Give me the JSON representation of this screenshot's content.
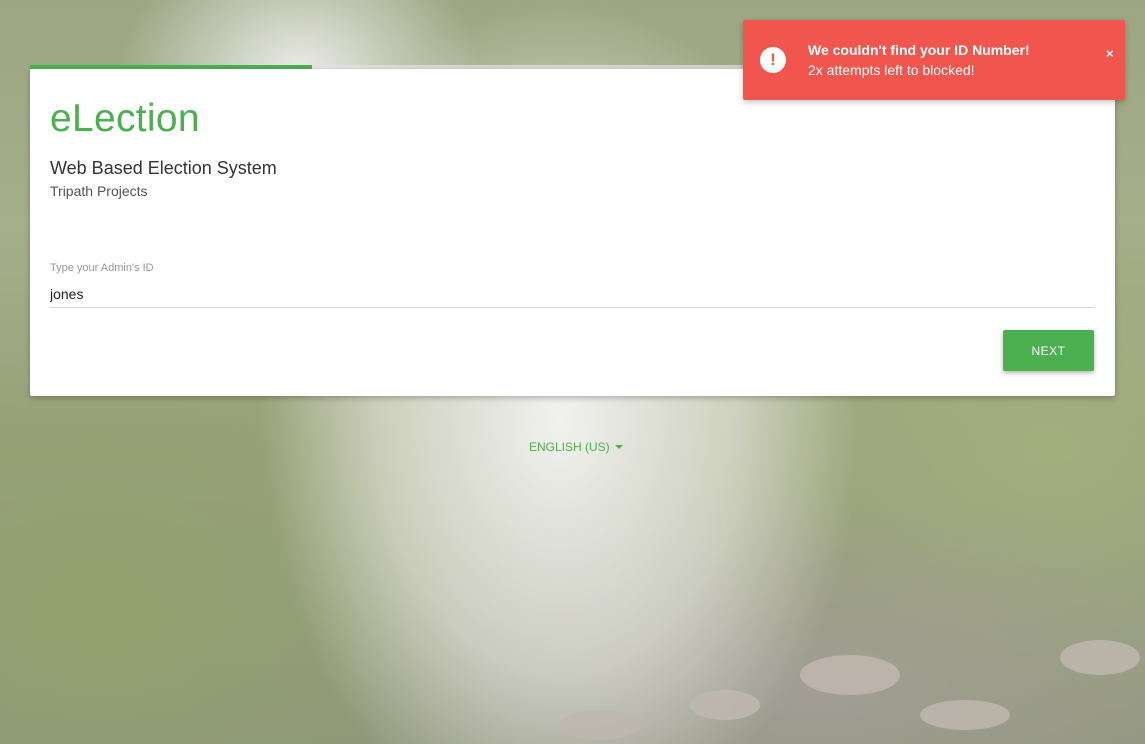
{
  "app": {
    "brand": "eLection",
    "subtitle": "Web Based Election System",
    "organization": "Tripath Projects"
  },
  "progress": {
    "fraction": 0.26
  },
  "form": {
    "label": "Type your Admin's ID",
    "value": "jones",
    "next_label": "NEXT"
  },
  "language": {
    "selected": "ENGLISH (US)"
  },
  "toast": {
    "title": "We couldn't find your ID Number!",
    "message": "2x attempts left to blocked!",
    "close": "×",
    "icon": "!"
  },
  "colors": {
    "accent": "#4caf50",
    "error": "#f0564e"
  }
}
